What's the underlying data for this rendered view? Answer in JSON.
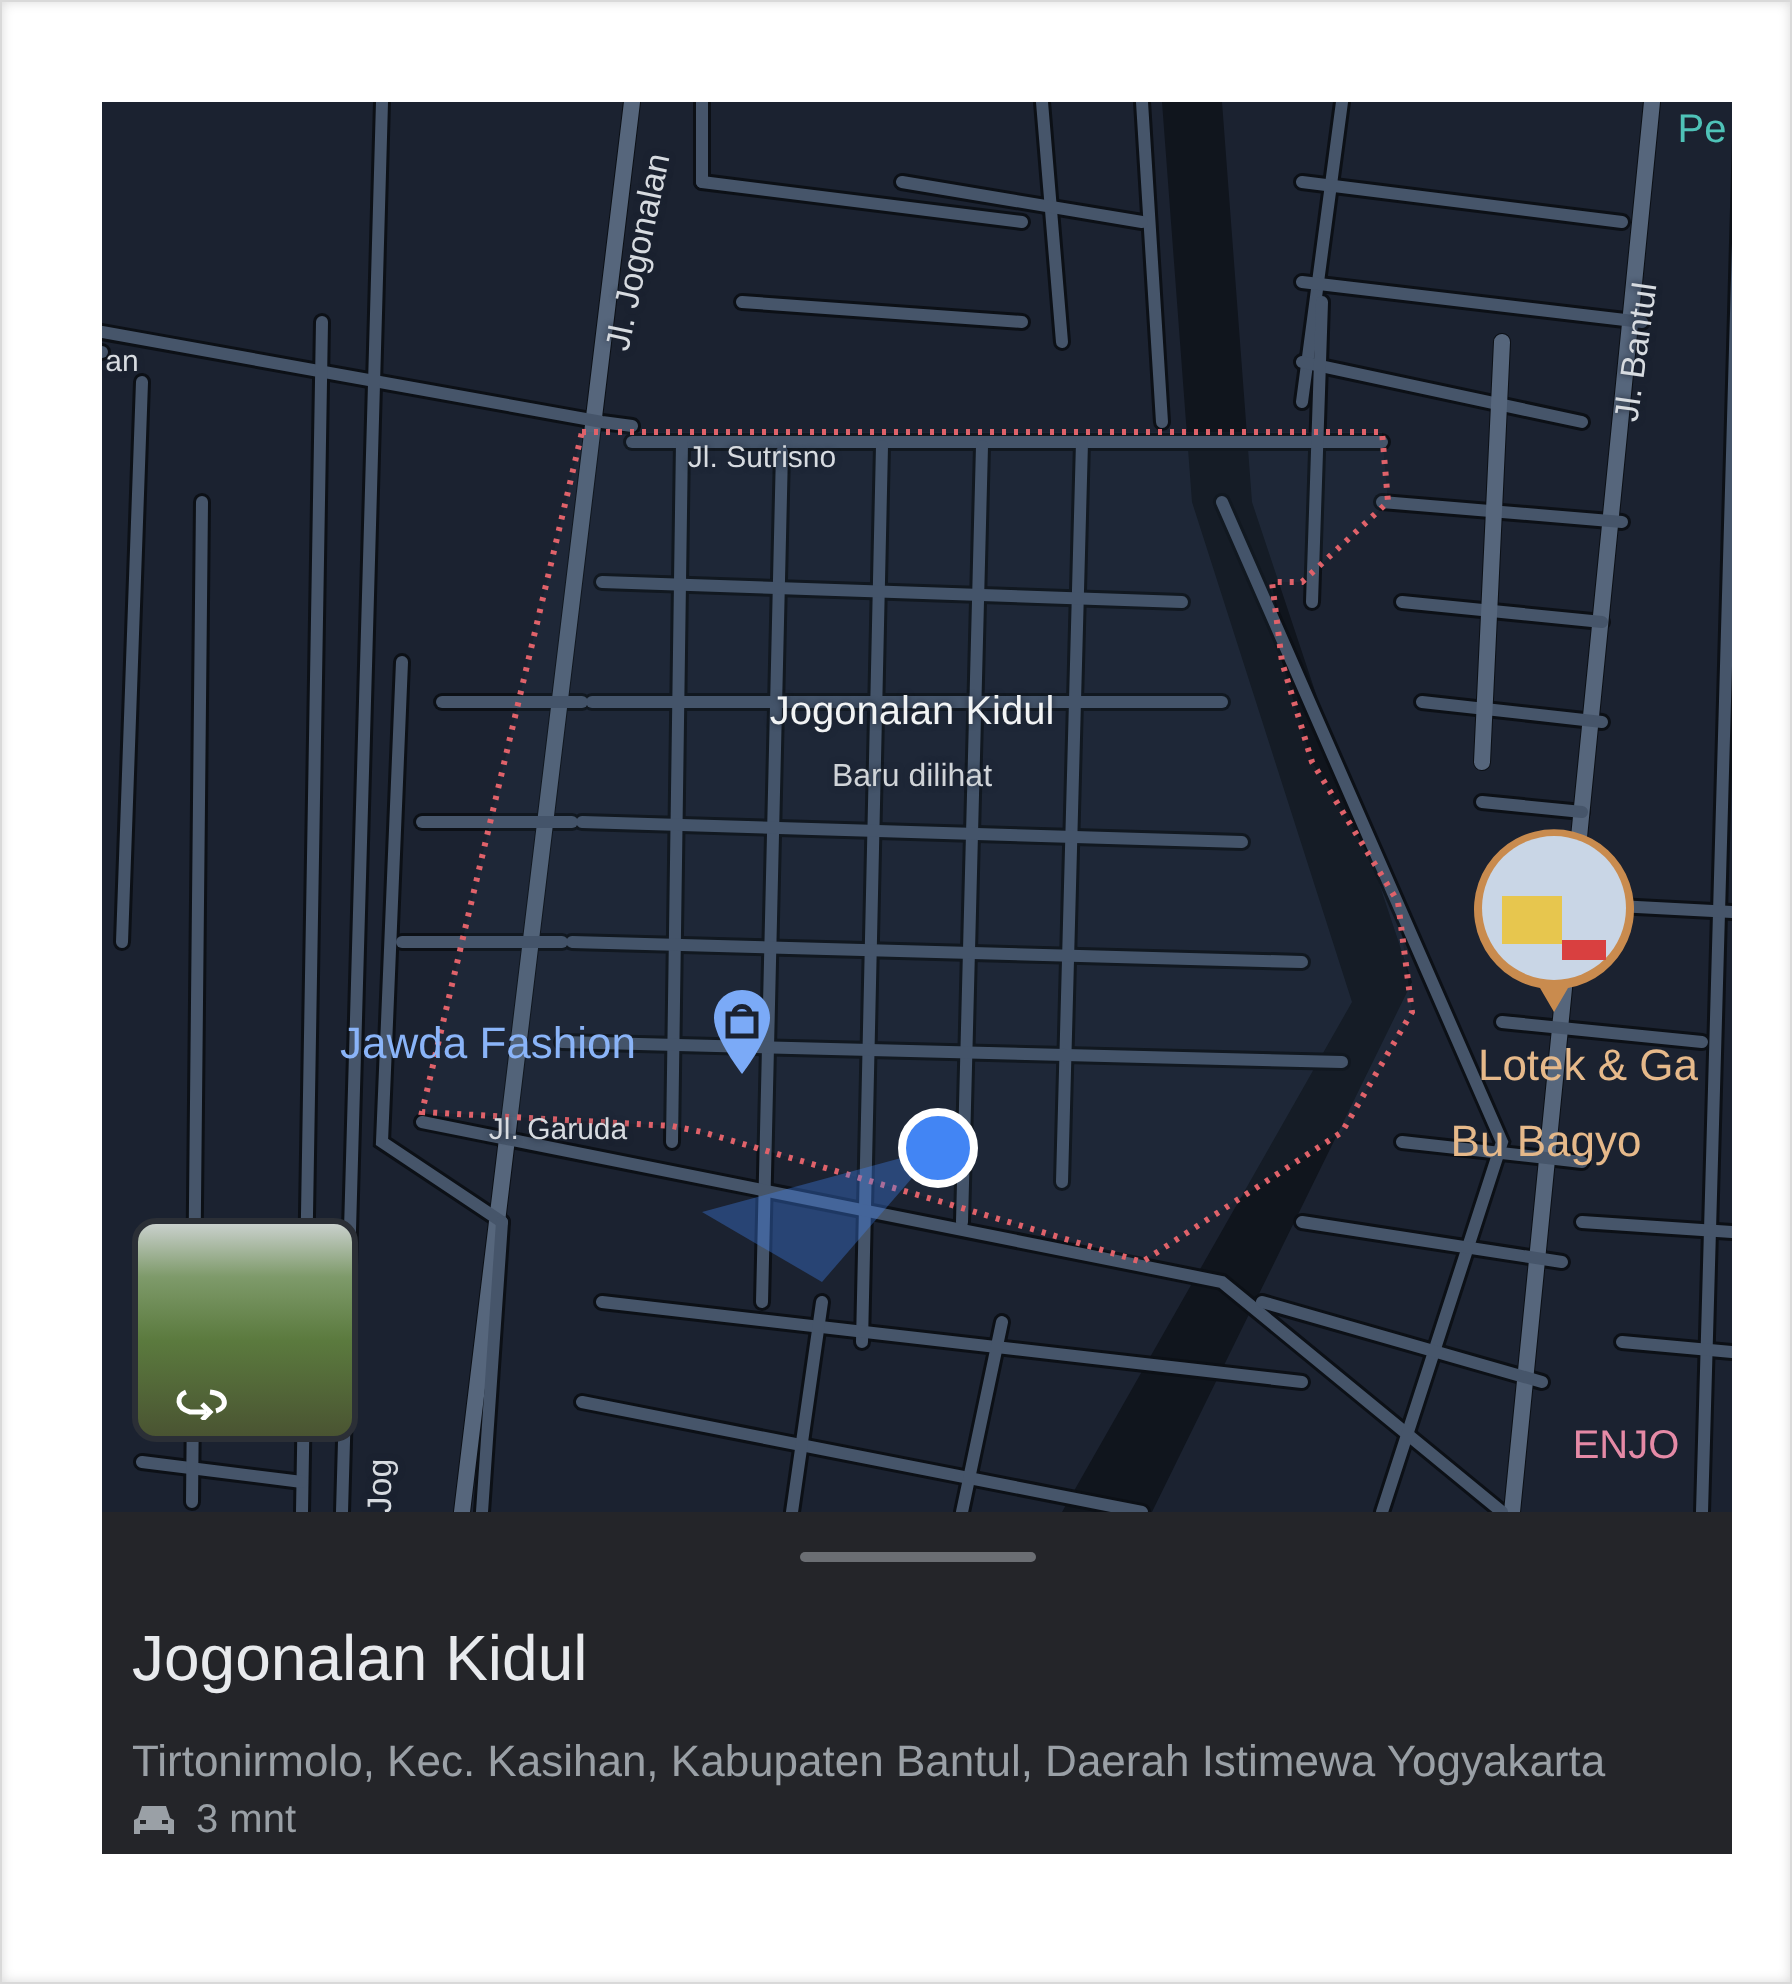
{
  "map": {
    "labels": [
      {
        "kind": "park",
        "text": "Pe"
      },
      {
        "kind": "street",
        "text": "an"
      },
      {
        "kind": "street-vertical",
        "text": "Jl. Jogonalan"
      },
      {
        "kind": "street-vertical",
        "text": "Jl. Bantul"
      },
      {
        "kind": "street",
        "text": "Jl. Sutrisno"
      },
      {
        "kind": "area",
        "text": "Jogonalan Kidul"
      },
      {
        "kind": "area-note",
        "text": "Baru dilihat"
      },
      {
        "kind": "shop",
        "text": "Jawda Fashion"
      },
      {
        "kind": "street",
        "text": "Jl. Garuda"
      },
      {
        "kind": "food",
        "text": "Lotek & Ga"
      },
      {
        "kind": "food",
        "text": "Bu Bagyo"
      },
      {
        "kind": "venue",
        "text": "ENJO"
      },
      {
        "kind": "street-vertical",
        "text": "Jog"
      }
    ]
  },
  "sheet": {
    "title": "Jogonalan Kidul",
    "address": "Tirtonirmolo, Kec. Kasihan, Kabupaten Bantul, Daerah Istimewa Yogyakarta",
    "travel": {
      "kind": "car",
      "time": "3 mnt"
    }
  }
}
